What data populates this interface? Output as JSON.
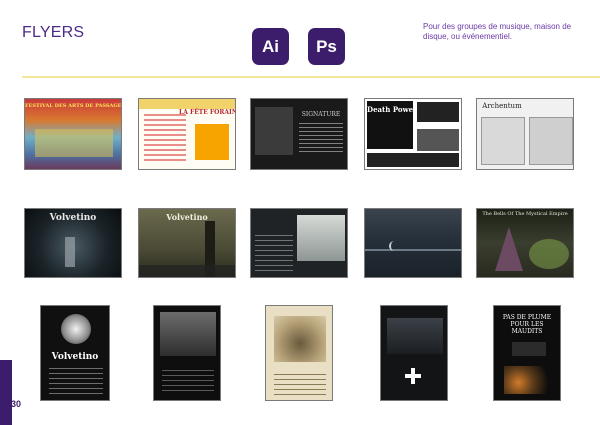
{
  "header": {
    "title": "FLYERS",
    "apps": [
      {
        "label": "Ai",
        "icon": "illustrator-icon"
      },
      {
        "label": "Ps",
        "icon": "photoshop-icon"
      }
    ],
    "description": "Pour des groupes de musique, maison de disque, ou événementiel."
  },
  "colors": {
    "accent": "#4b2a86",
    "badge": "#3b1d6b",
    "rule": "#f4e79b"
  },
  "flyers": [
    {
      "caption": "FESTIVAL DES ARTS DE PASSAGE"
    },
    {
      "caption": "LA FÊTE FORAINE"
    },
    {
      "caption": "SIGNATURE"
    },
    {
      "caption": "Death Power"
    },
    {
      "caption": "Archentum"
    },
    {
      "caption": "Volvetino"
    },
    {
      "caption": "Volvetino"
    },
    {
      "caption": ""
    },
    {
      "caption": ""
    },
    {
      "caption": "The Bells Of The Mystical Empire"
    },
    {
      "caption": "Volvetino"
    },
    {
      "caption": ""
    },
    {
      "caption": ""
    },
    {
      "caption": ""
    },
    {
      "caption": "PAS DE PLUME POUR LES MAUDITS"
    }
  ],
  "footer": {
    "page_number": "30"
  }
}
